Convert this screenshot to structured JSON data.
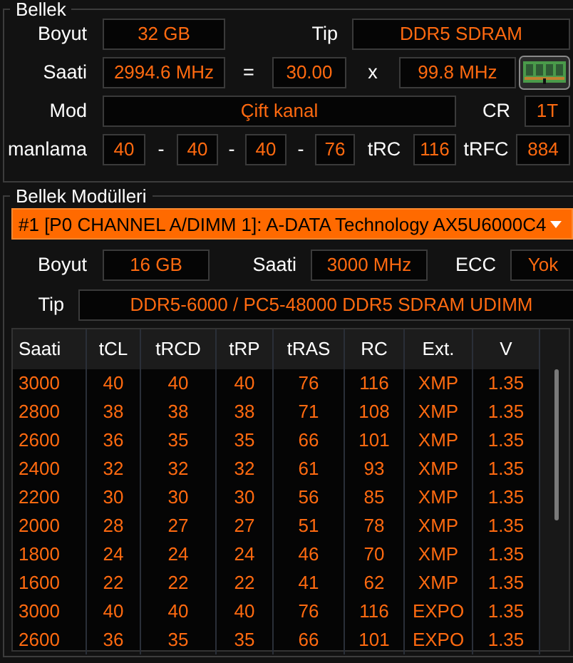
{
  "memory": {
    "title": "Bellek",
    "size_label": "Boyut",
    "size": "32 GB",
    "type_label": "Tip",
    "type": "DDR5 SDRAM",
    "clock_label": "Saati",
    "clock": "2994.6 MHz",
    "equals": "=",
    "multiplier": "30.00",
    "times": "x",
    "bus_clock": "99.8 MHz",
    "mode_label": "Mod",
    "mode": "Çift kanal",
    "cr_label": "CR",
    "cr": "1T",
    "timings_label": "manlama",
    "timings": [
      "40",
      "40",
      "40",
      "76"
    ],
    "timing_separators": [
      "-",
      "-",
      "-"
    ],
    "trc_label": "tRC",
    "trc": "116",
    "trfc_label": "tRFC",
    "trfc": "884"
  },
  "modules": {
    "title": "Bellek Modülleri",
    "slot": "#1 [P0 CHANNEL A/DIMM 1]: A-DATA Technology AX5U6000C4",
    "size_label": "Boyut",
    "size": "16 GB",
    "clock_label": "Saati",
    "clock": "3000 MHz",
    "ecc_label": "ECC",
    "ecc": "Yok",
    "type_label": "Tip",
    "type": "DDR5-6000 / PC5-48000 DDR5 SDRAM UDIMM",
    "table": {
      "columns": [
        "Saati",
        "tCL",
        "tRCD",
        "tRP",
        "tRAS",
        "RC",
        "Ext.",
        "V"
      ],
      "rows": [
        [
          "3000",
          "40",
          "40",
          "40",
          "76",
          "116",
          "XMP",
          "1.35"
        ],
        [
          "2800",
          "38",
          "38",
          "38",
          "71",
          "108",
          "XMP",
          "1.35"
        ],
        [
          "2600",
          "36",
          "35",
          "35",
          "66",
          "101",
          "XMP",
          "1.35"
        ],
        [
          "2400",
          "32",
          "32",
          "32",
          "61",
          "93",
          "XMP",
          "1.35"
        ],
        [
          "2200",
          "30",
          "30",
          "30",
          "56",
          "85",
          "XMP",
          "1.35"
        ],
        [
          "2000",
          "28",
          "27",
          "27",
          "51",
          "78",
          "XMP",
          "1.35"
        ],
        [
          "1800",
          "24",
          "24",
          "24",
          "46",
          "70",
          "XMP",
          "1.35"
        ],
        [
          "1600",
          "22",
          "22",
          "22",
          "41",
          "62",
          "XMP",
          "1.35"
        ],
        [
          "3000",
          "40",
          "40",
          "40",
          "76",
          "116",
          "EXPO",
          "1.35"
        ],
        [
          "2600",
          "36",
          "35",
          "35",
          "66",
          "101",
          "EXPO",
          "1.35"
        ]
      ]
    }
  }
}
